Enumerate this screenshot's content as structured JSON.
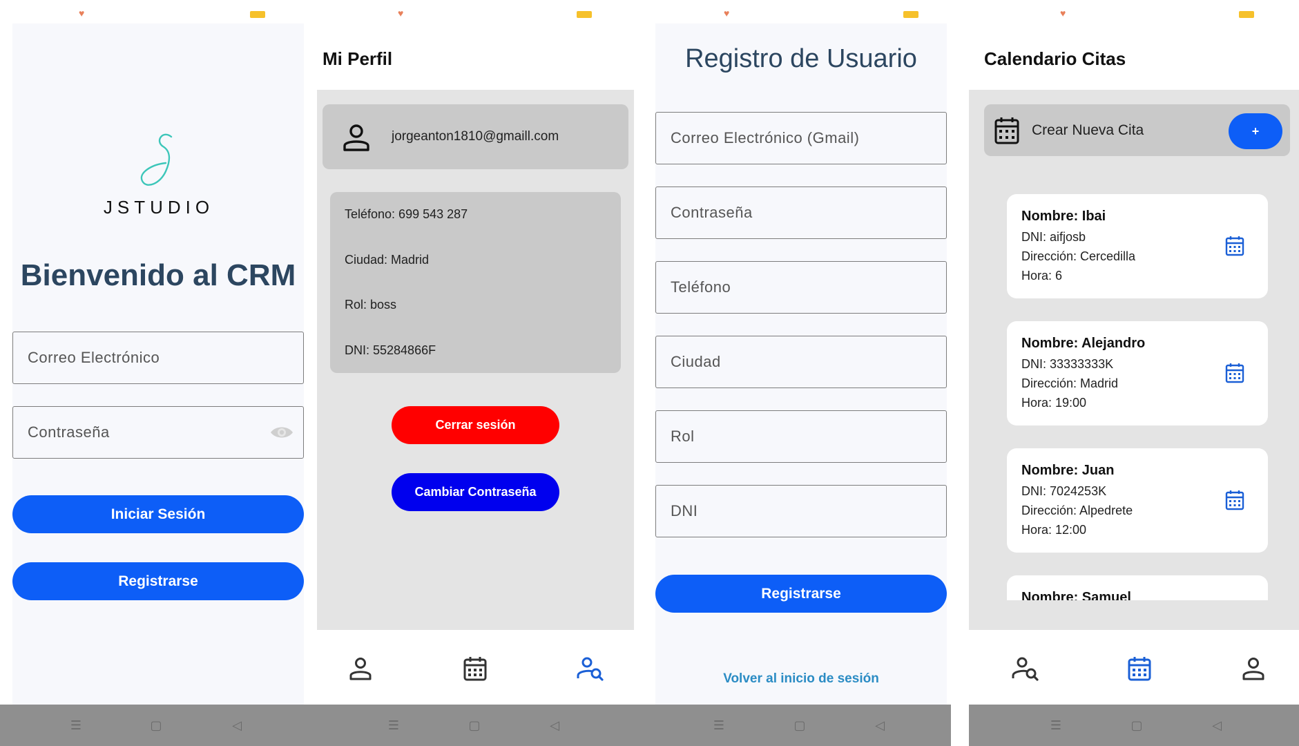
{
  "login": {
    "logo_text": "JSTUDIO",
    "welcome": "Bienvenido al CRM",
    "email_placeholder": "Correo Electrónico",
    "password_placeholder": "Contraseña",
    "login_button": "Iniciar Sesión",
    "register_button": "Registrarse"
  },
  "profile": {
    "title": "Mi Perfil",
    "email": "jorgeanton1810@gmaill.com",
    "phone": "Teléfono: 699 543 287",
    "city": "Ciudad: Madrid",
    "role": "Rol: boss",
    "dni": "DNI: 55284866F",
    "logout_button": "Cerrar sesión",
    "change_password_button": "Cambiar Contraseña"
  },
  "register": {
    "title": "Registro de Usuario",
    "fields": [
      "Correo Electrónico (Gmail)",
      "Contraseña",
      "Teléfono",
      "Ciudad",
      "Rol",
      "DNI"
    ],
    "register_button": "Registrarse",
    "back_link": "Volver al inicio de sesión"
  },
  "calendar": {
    "title": "Calendario Citas",
    "new_cita": "Crear Nueva Cita",
    "add_button": "+",
    "citas": [
      {
        "nombre": "Nombre: Ibai",
        "dni": "DNI: aifjosb",
        "direccion": "Dirección: Cercedilla",
        "hora": "Hora: 6"
      },
      {
        "nombre": "Nombre: Alejandro",
        "dni": "DNI: 33333333K",
        "direccion": "Dirección: Madrid",
        "hora": "Hora: 19:00"
      },
      {
        "nombre": "Nombre: Juan",
        "dni": "DNI: 7024253K",
        "direccion": "Dirección: Alpedrete",
        "hora": "Hora: 12:00"
      },
      {
        "nombre": "Nombre: Samuel",
        "dni": "",
        "direccion": "",
        "hora": ""
      }
    ]
  },
  "colors": {
    "primary_blue": "#0d5ef7",
    "logout_red": "#ff0000",
    "password_blue": "#0000ee",
    "heading": "#2c4660",
    "link": "#2b8cc4",
    "nav_active": "#1a5fd6"
  },
  "icons": {
    "person": "person-icon",
    "calendar": "calendar-icon",
    "person_search": "person-search-icon",
    "eye": "eye-icon",
    "heart": "heart-icon",
    "battery": "battery-icon",
    "menu": "menu-icon",
    "home": "home-square-icon",
    "back": "back-triangle-icon"
  }
}
